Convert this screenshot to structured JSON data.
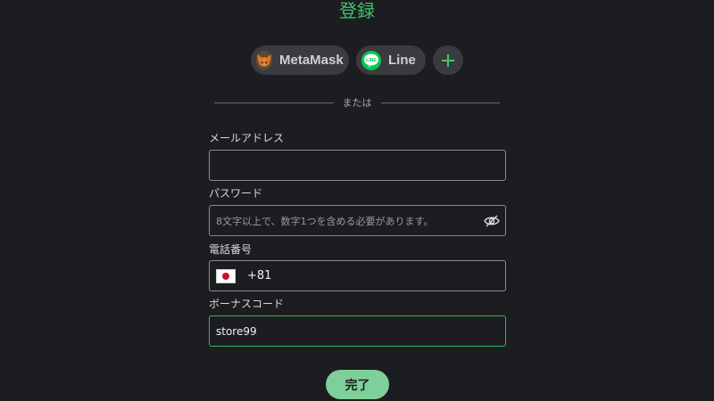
{
  "page": {
    "title": "登録"
  },
  "social": {
    "metamask_label": "MetaMask",
    "line_label": "Line",
    "more_label": "+",
    "line_icon_text": "LINE"
  },
  "divider": {
    "text": "または"
  },
  "form": {
    "email": {
      "label": "メールアドレス",
      "value": "",
      "placeholder": ""
    },
    "password": {
      "label": "パスワード",
      "value": "",
      "placeholder": "8文字以上で、数字1つを含める必要があります。"
    },
    "phone": {
      "label": "電話番号",
      "country_flag": "JP",
      "dial_code": "+81",
      "value": ""
    },
    "bonus_code": {
      "label": "ボーナスコード",
      "value": "store99"
    }
  },
  "submit": {
    "label": "完了"
  },
  "colors": {
    "background": "#1c1d20",
    "accent": "#3ec46a",
    "submit_bg": "#7fcf9a",
    "focus_border": "#2fb85a"
  }
}
